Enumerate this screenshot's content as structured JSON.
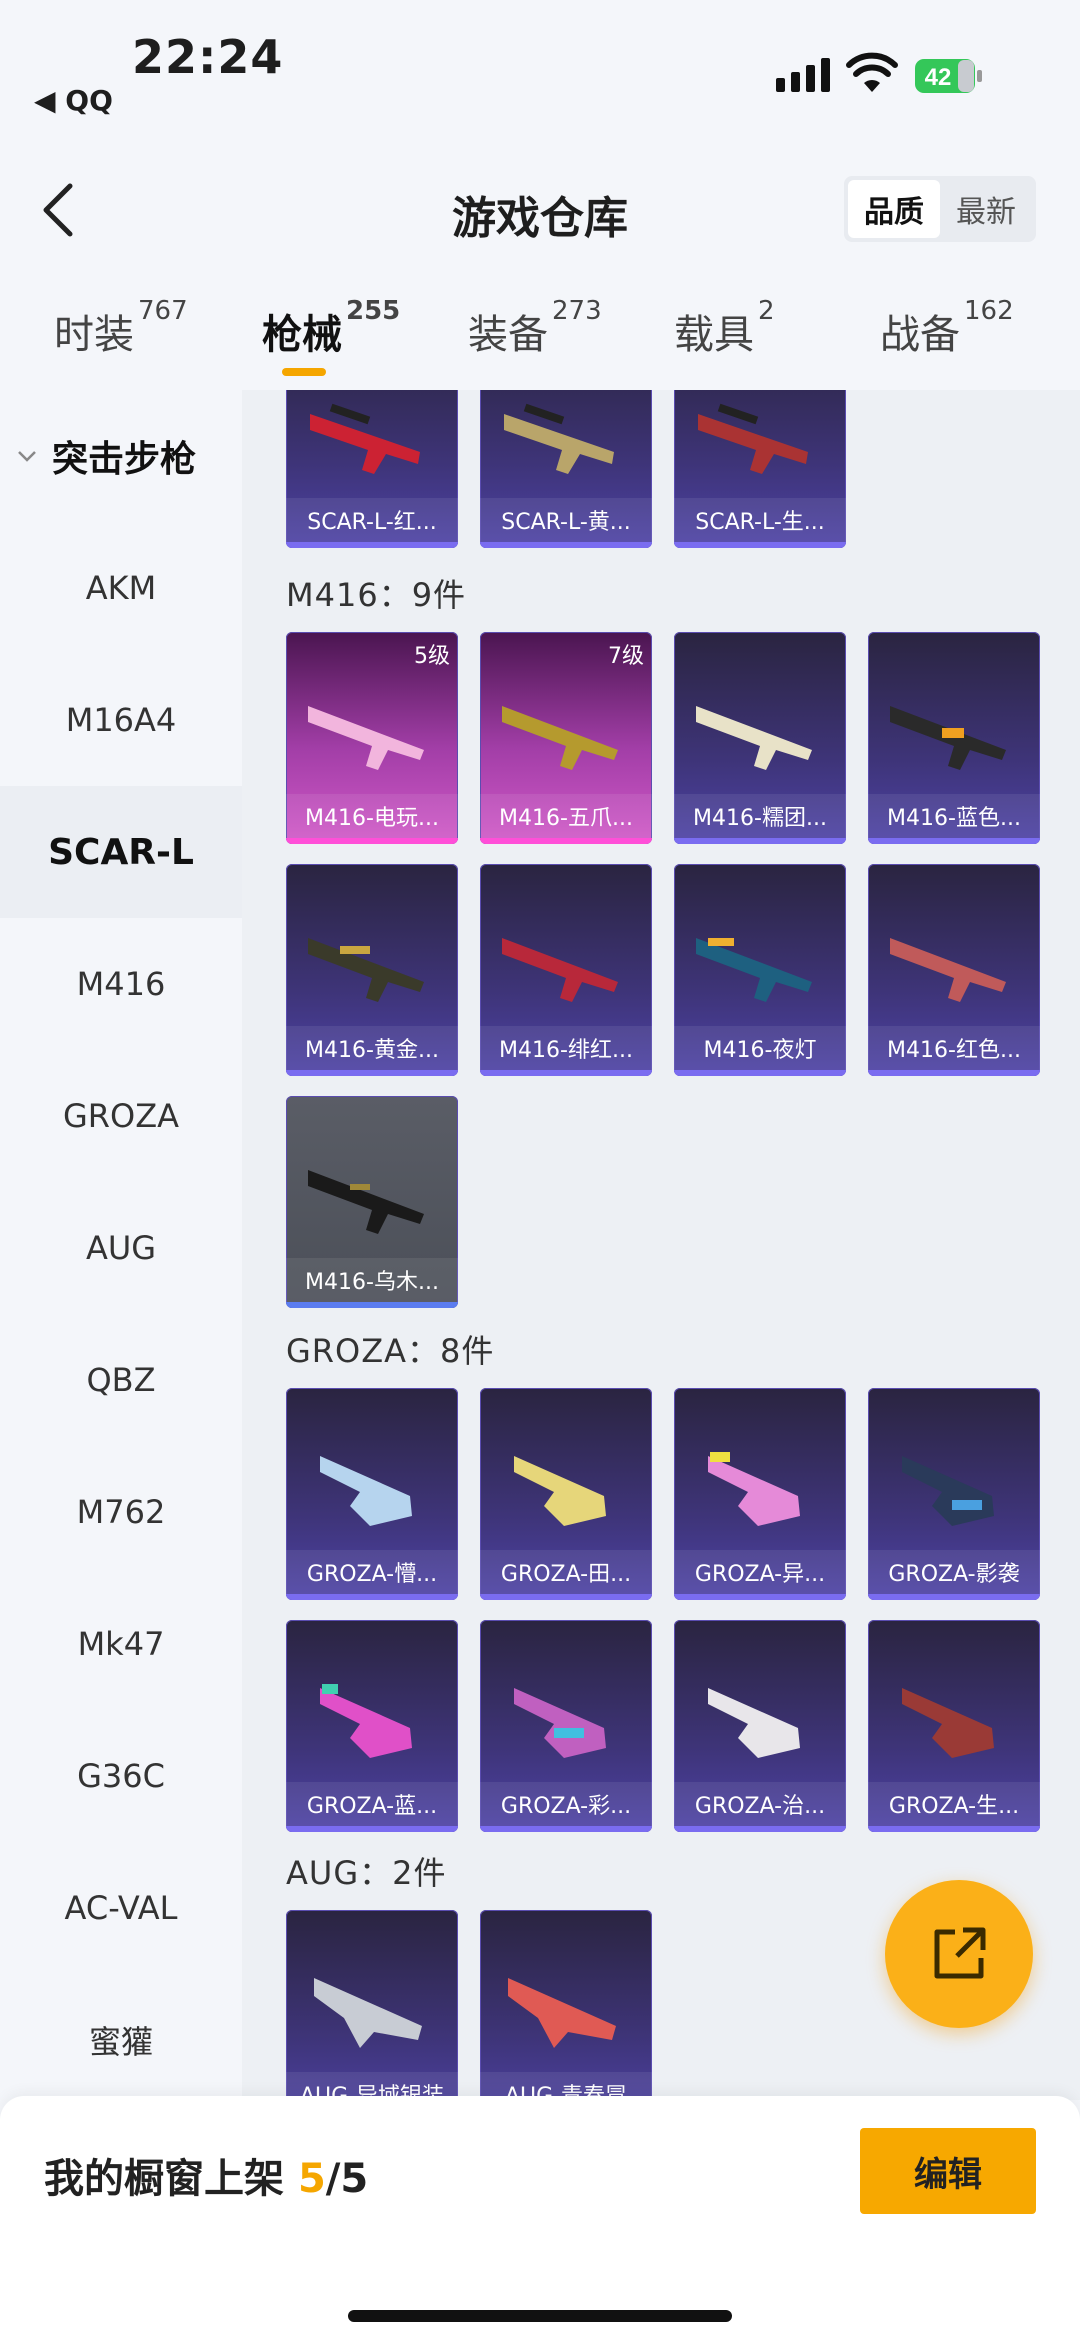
{
  "status_bar": {
    "time": "22:24",
    "back_app": "◀ QQ",
    "battery": "42"
  },
  "header": {
    "title": "游戏仓库",
    "sort_options": [
      "品质",
      "最新"
    ]
  },
  "tabs": [
    {
      "label": "时装",
      "count": "767"
    },
    {
      "label": "枪械",
      "count": "255"
    },
    {
      "label": "装备",
      "count": "273"
    },
    {
      "label": "载具",
      "count": "2"
    },
    {
      "label": "战备",
      "count": "162"
    }
  ],
  "sidebar": {
    "group": "突击步枪",
    "items": [
      "AKM",
      "M16A4",
      "SCAR-L",
      "M416",
      "GROZA",
      "AUG",
      "QBZ",
      "M762",
      "Mk47",
      "G36C",
      "AC-VAL",
      "蜜獾"
    ],
    "active": "SCAR-L"
  },
  "sections": {
    "scar": {
      "cards": [
        "SCAR-L-红...",
        "SCAR-L-黄...",
        "SCAR-L-生..."
      ]
    },
    "m416": {
      "title": "M416：9件",
      "cards": [
        "M416-电玩...",
        "M416-五爪...",
        "M416-糯团...",
        "M416-蓝色...",
        "M416-黄金...",
        "M416-绯红...",
        "M416-夜灯",
        "M416-红色...",
        "M416-乌木..."
      ],
      "levels": [
        "5级",
        "7级"
      ]
    },
    "groza": {
      "title": "GROZA：8件",
      "cards": [
        "GROZA-懵...",
        "GROZA-田...",
        "GROZA-异...",
        "GROZA-影袭",
        "GROZA-蓝...",
        "GROZA-彩...",
        "GROZA-治...",
        "GROZA-生..."
      ]
    },
    "aug": {
      "title": "AUG：2件",
      "cards": [
        "AUG-异域银装",
        "AUG-青春冒"
      ]
    }
  },
  "bottom": {
    "shelf_label": "我的橱窗上架",
    "shelf_current": "5",
    "shelf_total": "/5",
    "edit_label": "编辑"
  },
  "colors": {
    "accent": "#f5a600",
    "card_purple": "#3e3478",
    "card_magenta": "#a23ea7"
  }
}
